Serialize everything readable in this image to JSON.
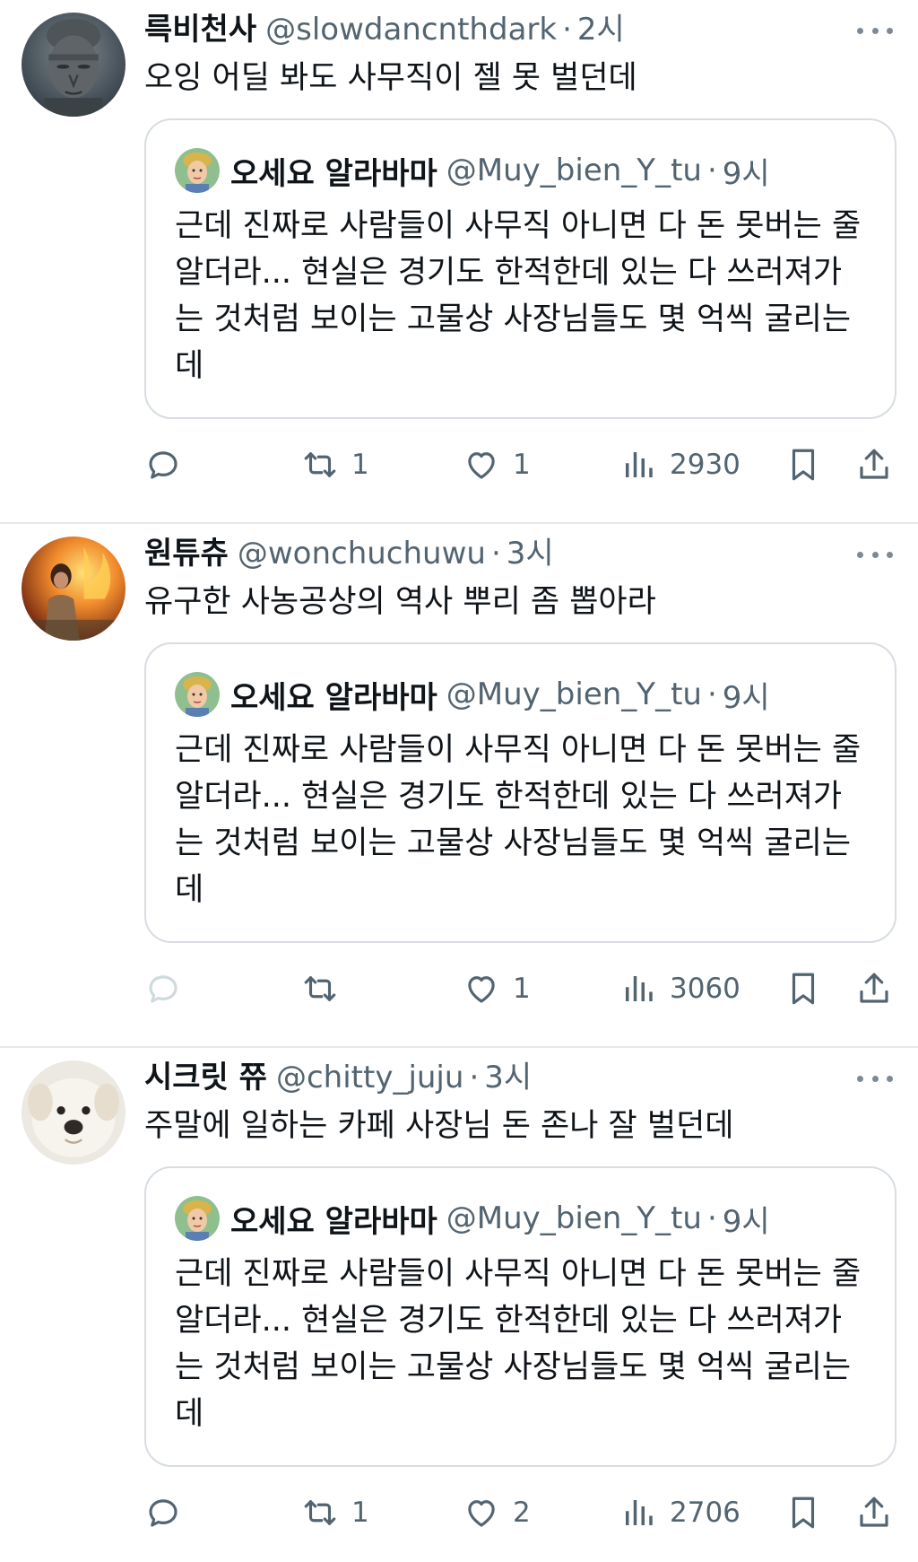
{
  "tweets": [
    {
      "name": "륵비천사",
      "handle": "@slowdancnthdark",
      "time": "2시",
      "text": "오잉 어딜 봐도 사무직이 젤 못 벌던데",
      "avatar": "buddha-statue-avatar",
      "quote": {
        "name": "오세요 알라바마",
        "handle": "@Muy_bien_Y_tu",
        "time": "9시",
        "text": "근데 진짜로 사람들이 사무직 아니면 다 돈 못버는 줄 알더라... 현실은 경기도 한적한데 있는 다 쓰러져가는 것처럼 보이는 고물상 사장님들도 몇 억씩 굴리는데"
      },
      "stats": {
        "replies": "",
        "retweets": "1",
        "likes": "1",
        "views": "2930"
      }
    },
    {
      "name": "원튜츄",
      "handle": "@wonchuchuwu",
      "time": "3시",
      "text": "유구한 사농공상의 역사 뿌리 좀 뽑아라",
      "avatar": "fire-person-avatar",
      "quote": {
        "name": "오세요 알라바마",
        "handle": "@Muy_bien_Y_tu",
        "time": "9시",
        "text": "근데 진짜로 사람들이 사무직 아니면 다 돈 못버는 줄 알더라... 현실은 경기도 한적한데 있는 다 쓰러져가는 것처럼 보이는 고물상 사장님들도 몇 억씩 굴리는데"
      },
      "stats": {
        "replies": "",
        "retweets": "",
        "likes": "1",
        "views": "3060"
      }
    },
    {
      "name": "시크릿 쮸",
      "handle": "@chitty_juju",
      "time": "3시",
      "text": "주말에 일하는 카페 사장님 돈 존나 잘 벌던데",
      "avatar": "puppy-avatar",
      "quote": {
        "name": "오세요 알라바마",
        "handle": "@Muy_bien_Y_tu",
        "time": "9시",
        "text": "근데 진짜로 사람들이 사무직 아니면 다 돈 못버는 줄 알더라... 현실은 경기도 한적한데 있는 다 쓰러져가는 것처럼 보이는 고물상 사장님들도 몇 억씩 굴리는데"
      },
      "stats": {
        "replies": "",
        "retweets": "1",
        "likes": "2",
        "views": "2706"
      }
    }
  ],
  "colors": {
    "text_primary": "#0f1419",
    "text_secondary": "#536471",
    "border": "#d7dde2",
    "divider": "#e6e9eb",
    "reply_disabled": "#cfd9de"
  }
}
